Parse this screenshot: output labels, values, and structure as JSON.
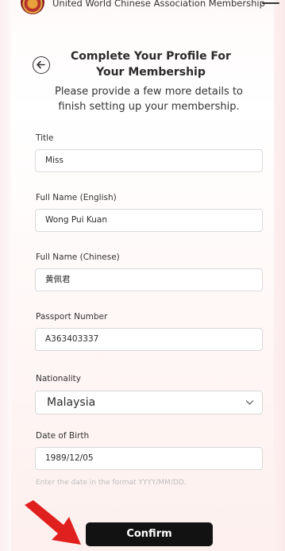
{
  "header": {
    "title": "United World Chinese Association Membership"
  },
  "page": {
    "title": "Complete Your Profile For Your Membership",
    "subtitle": "Please provide a few more details to finish setting up your membership."
  },
  "form": {
    "title_label": "Title",
    "title_value": "Miss",
    "name_en_label": "Full Name (English)",
    "name_en_value": "Wong Pui Kuan",
    "name_zh_label": "Full Name (Chinese)",
    "name_zh_value": "黄佩君",
    "passport_label": "Passport Number",
    "passport_value": "A363403337",
    "nationality_label": "Nationality",
    "nationality_value": "Malaysia",
    "dob_label": "Date of Birth",
    "dob_value": "1989/12/05",
    "dob_hint": "Enter the date in the format YYYY/MM/DD."
  },
  "actions": {
    "confirm_label": "Confirm"
  },
  "colors": {
    "accent": "#121212",
    "annotation_arrow": "#e0201f"
  },
  "icons": {
    "back": "arrow-left-circle-icon",
    "menu": "hamburger-menu-icon",
    "dropdown": "chevron-down-icon",
    "logo": "association-logo-icon"
  }
}
